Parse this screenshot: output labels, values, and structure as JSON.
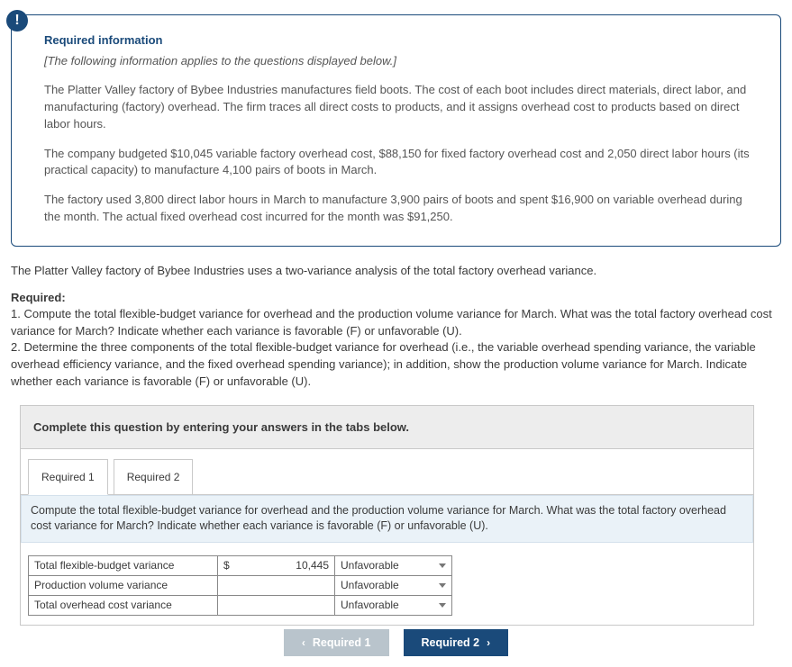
{
  "infoCard": {
    "badgeGlyph": "!",
    "title": "Required information",
    "subtitle": "[The following information applies to the questions displayed below.]",
    "para1": "The Platter Valley factory of Bybee Industries manufactures field boots. The cost of each boot includes direct materials, direct labor, and manufacturing (factory) overhead. The firm traces all direct costs to products, and it assigns overhead cost to products based on direct labor hours.",
    "para2": "The company budgeted $10,045 variable factory overhead cost, $88,150 for fixed factory overhead cost and 2,050 direct labor hours (its practical capacity) to manufacture 4,100 pairs of boots in March.",
    "para3": "The factory used 3,800 direct labor hours in March to manufacture 3,900 pairs of boots and spent $16,900 on variable overhead during the month. The actual fixed overhead cost incurred for the month was $91,250."
  },
  "outerDesc": "The Platter Valley factory of Bybee Industries uses a two-variance analysis of the total factory overhead variance.",
  "requiredLabel": "Required:",
  "req1": "1. Compute the total flexible-budget variance for overhead and the production volume variance for March. What was the total factory overhead cost variance for March? Indicate whether each variance is favorable (F) or unfavorable (U).",
  "req2": "2. Determine the three components of the total flexible-budget variance for overhead (i.e., the variable overhead spending variance, the variable overhead efficiency variance, and the fixed overhead spending variance); in addition, show the production volume variance for March. Indicate whether each variance is favorable (F) or unfavorable (U).",
  "answerHeader": "Complete this question by entering your answers in the tabs below.",
  "tabs": {
    "t1": "Required 1",
    "t2": "Required 2"
  },
  "tabInstruction": "Compute the total flexible-budget variance for overhead and the production volume variance for March. What was the total factory overhead cost variance for March? Indicate whether each variance is favorable (F) or unfavorable (U).",
  "rows": {
    "r1": {
      "label": "Total flexible-budget variance",
      "currency": "$",
      "amount": "10,445",
      "fav": "Unfavorable"
    },
    "r2": {
      "label": "Production volume variance",
      "currency": "",
      "amount": "",
      "fav": "Unfavorable"
    },
    "r3": {
      "label": "Total overhead cost variance",
      "currency": "",
      "amount": "",
      "fav": "Unfavorable"
    }
  },
  "nav": {
    "prev": "Required 1",
    "next": "Required 2"
  }
}
